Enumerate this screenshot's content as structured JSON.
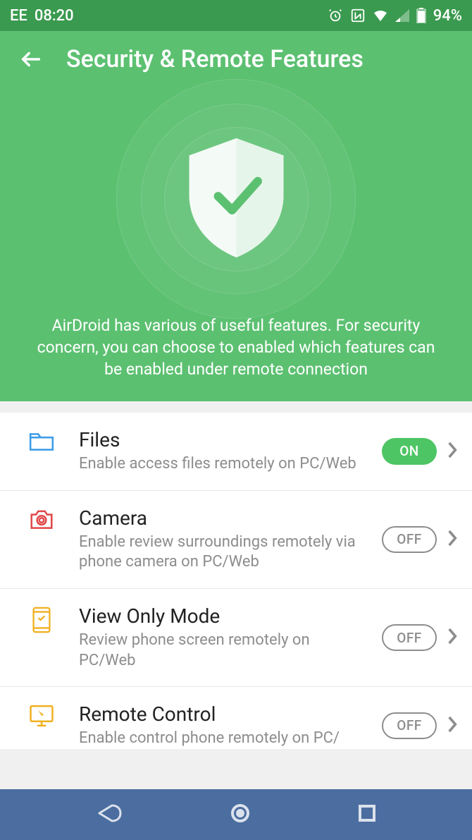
{
  "status": {
    "carrier": "EE",
    "time": "08:20",
    "battery": "94%"
  },
  "header": {
    "title": "Security & Remote Features",
    "description": "AirDroid has various of useful features. For security concern, you can choose to enabled which features can be enabled under remote connection"
  },
  "toggles": {
    "on": "ON",
    "off": "OFF"
  },
  "settings": [
    {
      "id": "files",
      "title": "Files",
      "desc": "Enable access files remotely on PC/Web",
      "state": "on",
      "icon_color": "#3a9be8"
    },
    {
      "id": "camera",
      "title": "Camera",
      "desc": "Enable review surroundings remotely via phone camera on PC/Web",
      "state": "off",
      "icon_color": "#e04848"
    },
    {
      "id": "view-only",
      "title": "View Only Mode",
      "desc": "Review phone screen remotely on PC/Web",
      "state": "off",
      "icon_color": "#f0b020"
    },
    {
      "id": "remote-control",
      "title": "Remote Control",
      "desc": "Enable control phone remotely on PC/",
      "state": "off",
      "icon_color": "#f0b020"
    }
  ]
}
